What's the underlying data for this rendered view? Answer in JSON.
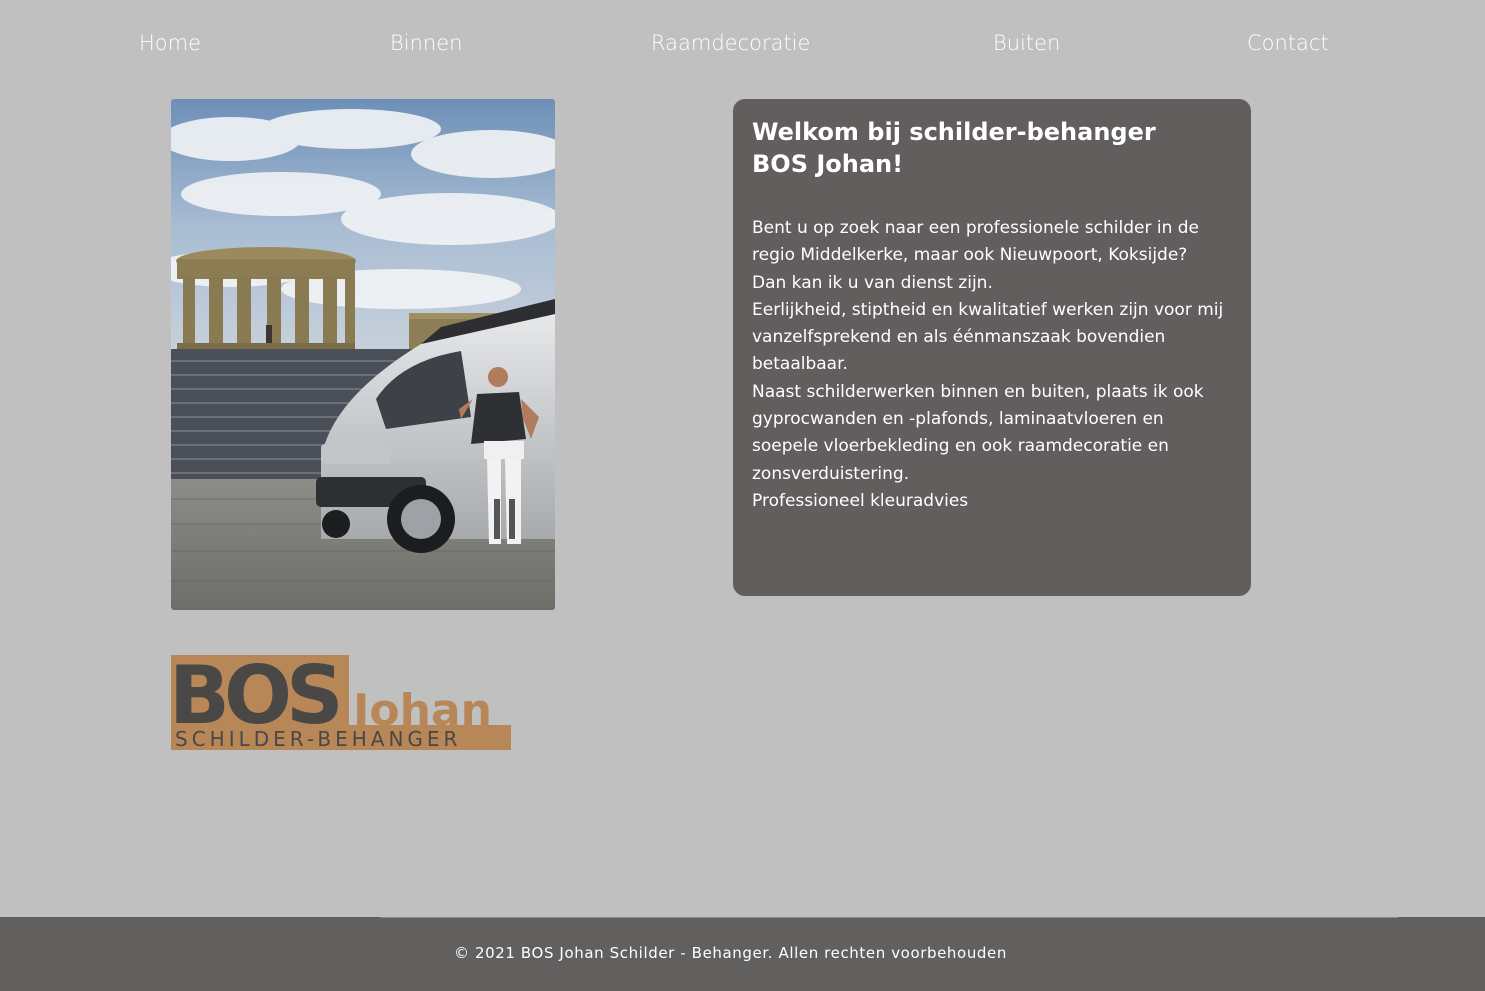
{
  "nav": {
    "items": [
      {
        "label": "Home"
      },
      {
        "label": "Binnen"
      },
      {
        "label": "Raamdecoratie"
      },
      {
        "label": "Buiten"
      },
      {
        "label": "Contact"
      }
    ]
  },
  "logo": {
    "brand": "BOS",
    "name": "Johan",
    "tagline": "SCHILDER-BEHANGER",
    "colors": {
      "dark": "#4a4847",
      "accent": "#b88757"
    }
  },
  "welcome": {
    "title": "Welkom bij schilder-behanger BOS Johan!",
    "paragraphs": [
      "Bent u op zoek naar een professionele schilder in de regio Middelkerke, maar ook Nieuwpoort, Koksijde?",
      "Dan kan ik u van dienst zijn.",
      "Eerlijkheid, stiptheid en kwalitatief werken zijn voor mij vanzelfsprekend en als éénmanszaak bovendien betaalbaar.",
      "Naast schilderwerken binnen en buiten, plaats ik ook gyprocwanden en -plafonds, laminaatvloeren en soepele vloerbekleding en ook raamdecoratie en zonsverduistering.",
      "Professioneel kleuradvies"
    ]
  },
  "footer": {
    "text": "© 2021 BOS Johan Schilder - Behanger. Allen rechten voorbehouden"
  },
  "colors": {
    "page_bg": "#c0c0c0",
    "card_bg": "#625e5d",
    "footer_bg": "#625f5f",
    "text": "#ffffff"
  }
}
